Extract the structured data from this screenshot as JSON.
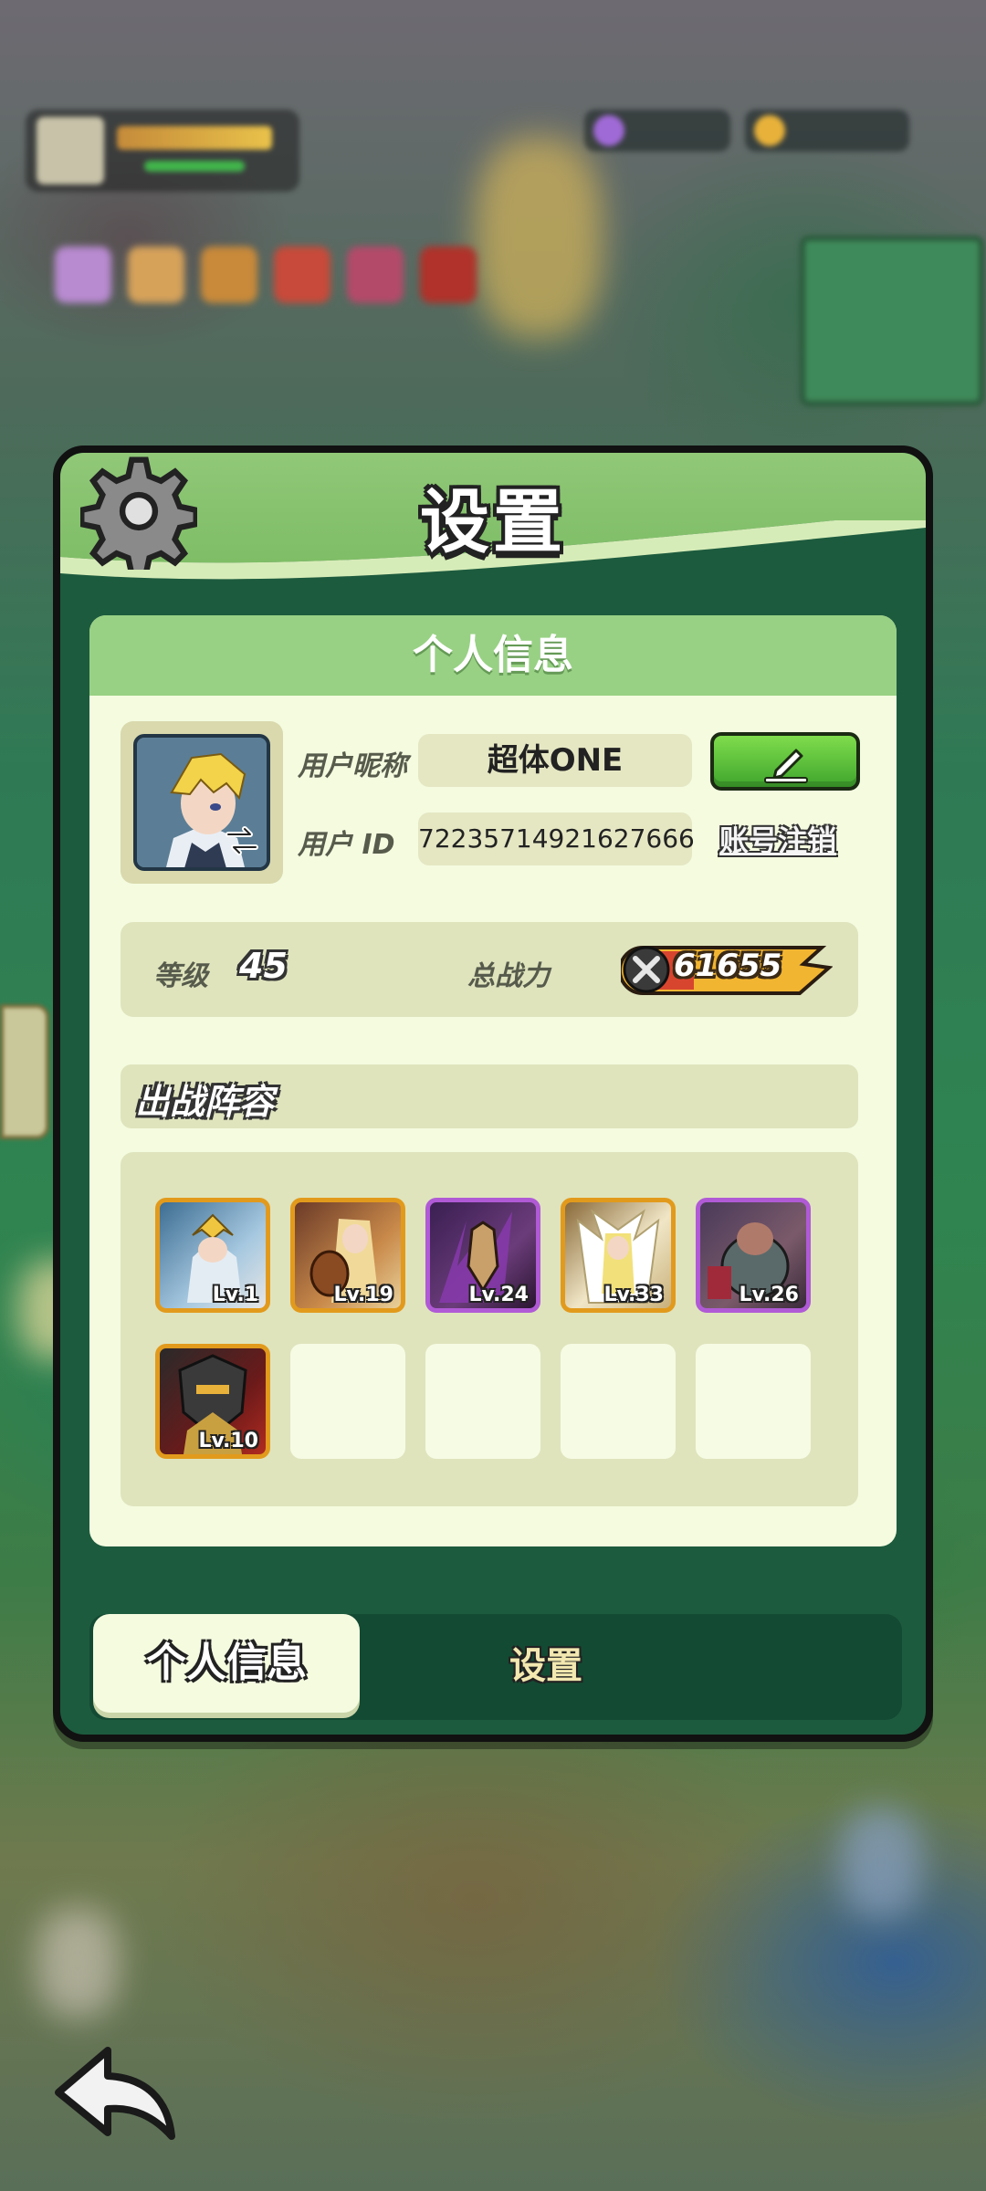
{
  "panel": {
    "title": "设置",
    "icon": "gear-icon"
  },
  "profile": {
    "section_title": "个人信息",
    "nickname_label": "用户昵称",
    "nickname_value": "超体ONE",
    "id_label": "用户 ID",
    "id_value": "72235714921627666",
    "cancel_account_label": "账号注销",
    "edit_icon": "pencil-icon"
  },
  "stats": {
    "level_label": "等级",
    "level_value": "45",
    "power_label": "总战力",
    "power_value": "61655"
  },
  "lineup": {
    "title": "出战阵容",
    "heroes": [
      {
        "level": "Lv.1",
        "rarity": "orange"
      },
      {
        "level": "Lv.19",
        "rarity": "orange"
      },
      {
        "level": "Lv.24",
        "rarity": "purple"
      },
      {
        "level": "Lv.33",
        "rarity": "orange"
      },
      {
        "level": "Lv.26",
        "rarity": "purple"
      },
      {
        "level": "Lv.10",
        "rarity": "orange"
      }
    ],
    "empty_slots": 4
  },
  "tabs": {
    "profile": "个人信息",
    "settings": "设置"
  },
  "colors": {
    "panel_green": "#1d5b3e",
    "header_green": "#7cbc63",
    "card_bg": "#f4fbdf",
    "orange_rarity": "#e29a1c",
    "purple_rarity": "#b05ad6",
    "edit_button": "#3fa52d"
  }
}
